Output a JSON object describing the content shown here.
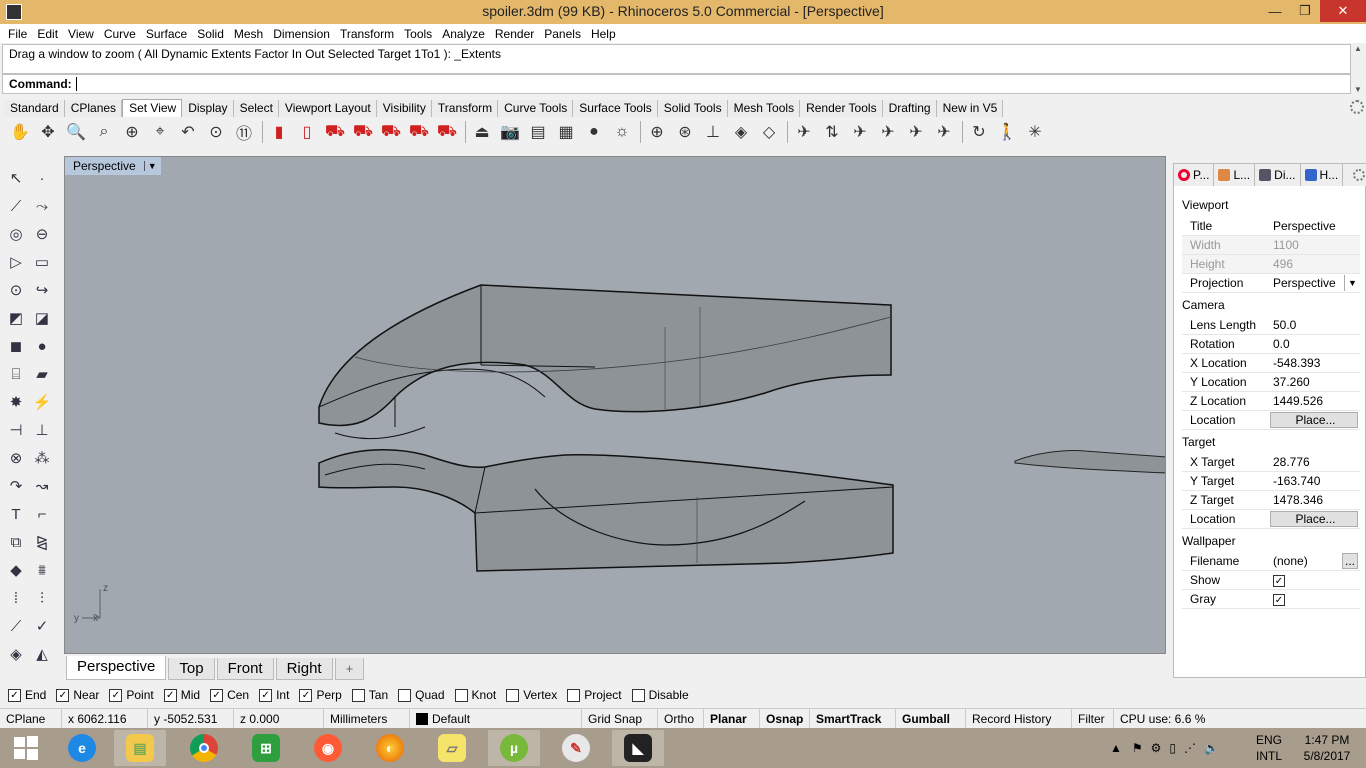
{
  "window": {
    "title": "spoiler.3dm (99 KB) - Rhinoceros 5.0 Commercial - [Perspective]",
    "minimize_glyph": "—",
    "maximize_glyph": "❐",
    "close_glyph": "✕"
  },
  "menu": [
    "File",
    "Edit",
    "View",
    "Curve",
    "Surface",
    "Solid",
    "Mesh",
    "Dimension",
    "Transform",
    "Tools",
    "Analyze",
    "Render",
    "Panels",
    "Help"
  ],
  "command": {
    "history": "Drag a window to zoom ( All  Dynamic  Extents  Factor  In  Out  Selected  Target  1To1 ): _Extents",
    "prompt_label": "Command:"
  },
  "toolbar_tabs": [
    "Standard",
    "CPlanes",
    "Set View",
    "Display",
    "Select",
    "Viewport Layout",
    "Visibility",
    "Transform",
    "Curve Tools",
    "Surface Tools",
    "Solid Tools",
    "Mesh Tools",
    "Render Tools",
    "Drafting",
    "New in V5"
  ],
  "active_toolbar_tab": "Set View",
  "viewport": {
    "title": "Perspective",
    "axis_x": "x",
    "axis_y": "y",
    "axis_z": "z"
  },
  "viewport_tabs": [
    "Perspective",
    "Top",
    "Front",
    "Right"
  ],
  "viewport_tab_add": "+",
  "panel": {
    "tabs": [
      "P...",
      "L...",
      "Di...",
      "H..."
    ],
    "sections": {
      "viewport": "Viewport",
      "camera": "Camera",
      "target": "Target",
      "wallpaper": "Wallpaper"
    },
    "viewport_props": {
      "title_k": "Title",
      "title_v": "Perspective",
      "width_k": "Width",
      "width_v": "1100",
      "height_k": "Height",
      "height_v": "496",
      "projection_k": "Projection",
      "projection_v": "Perspective"
    },
    "camera_props": {
      "lens_k": "Lens Length",
      "lens_v": "50.0",
      "rot_k": "Rotation",
      "rot_v": "0.0",
      "xloc_k": "X Location",
      "xloc_v": "-548.393",
      "yloc_k": "Y Location",
      "yloc_v": "37.260",
      "zloc_k": "Z Location",
      "zloc_v": "1449.526",
      "loc_k": "Location",
      "loc_btn": "Place..."
    },
    "target_props": {
      "xt_k": "X Target",
      "xt_v": "28.776",
      "yt_k": "Y Target",
      "yt_v": "-163.740",
      "zt_k": "Z Target",
      "zt_v": "1478.346",
      "loc_k": "Location",
      "loc_btn": "Place..."
    },
    "wallpaper_props": {
      "file_k": "Filename",
      "file_v": "(none)",
      "file_btn": "...",
      "show_k": "Show",
      "show_checked": true,
      "gray_k": "Gray",
      "gray_checked": true
    }
  },
  "osnaps": [
    {
      "label": "End",
      "checked": true
    },
    {
      "label": "Near",
      "checked": true
    },
    {
      "label": "Point",
      "checked": true
    },
    {
      "label": "Mid",
      "checked": true
    },
    {
      "label": "Cen",
      "checked": true
    },
    {
      "label": "Int",
      "checked": true
    },
    {
      "label": "Perp",
      "checked": true
    },
    {
      "label": "Tan",
      "checked": false
    },
    {
      "label": "Quad",
      "checked": false
    },
    {
      "label": "Knot",
      "checked": false
    },
    {
      "label": "Vertex",
      "checked": false
    },
    {
      "label": "Project",
      "checked": false
    },
    {
      "label": "Disable",
      "checked": false
    }
  ],
  "status": {
    "cplane": "CPlane",
    "x": "x 6062.116",
    "y": "y -5052.531",
    "z": "z 0.000",
    "units": "Millimeters",
    "layer": "Default",
    "grid_snap": "Grid Snap",
    "ortho": "Ortho",
    "planar": "Planar",
    "osnap": "Osnap",
    "smarttrack": "SmartTrack",
    "gumball": "Gumball",
    "record_history": "Record History",
    "filter": "Filter",
    "cpu": "CPU use: 6.6 %"
  },
  "taskbar": {
    "lang_top": "ENG",
    "lang_bottom": "INTL",
    "time": "1:47 PM",
    "date": "5/8/2017",
    "apps": [
      "windows-start",
      "internet-explorer",
      "file-explorer",
      "chrome",
      "store",
      "app-orange",
      "firefox",
      "sticky-notes",
      "utorrent",
      "paint",
      "rhino"
    ]
  }
}
